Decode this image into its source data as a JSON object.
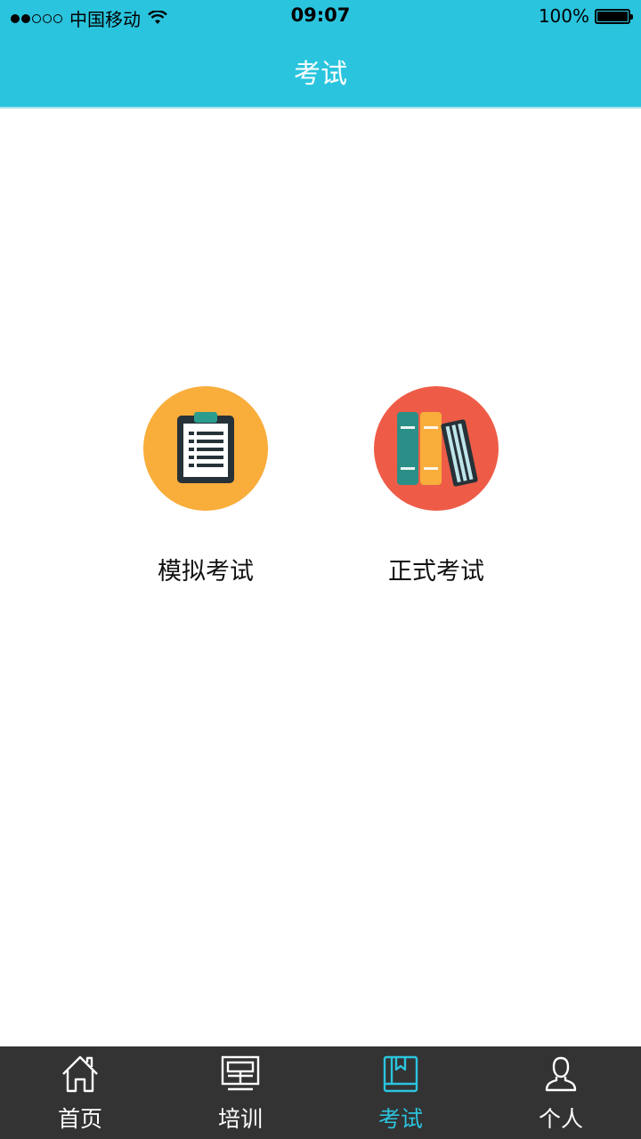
{
  "status_bar": {
    "carrier": "中国移动",
    "time": "09:07",
    "battery": "100%"
  },
  "nav": {
    "title": "考试"
  },
  "main": {
    "tiles": [
      {
        "label": "模拟考试",
        "icon": "clipboard-icon",
        "color": "#f9ad3b"
      },
      {
        "label": "正式考试",
        "icon": "books-icon",
        "color": "#ee5c47"
      }
    ]
  },
  "tab_bar": {
    "active_color": "#2bc4de",
    "items": [
      {
        "label": "首页",
        "icon": "home-icon"
      },
      {
        "label": "培训",
        "icon": "presentation-board-icon"
      },
      {
        "label": "考试",
        "icon": "book-icon",
        "active": true
      },
      {
        "label": "个人",
        "icon": "person-icon"
      }
    ]
  }
}
